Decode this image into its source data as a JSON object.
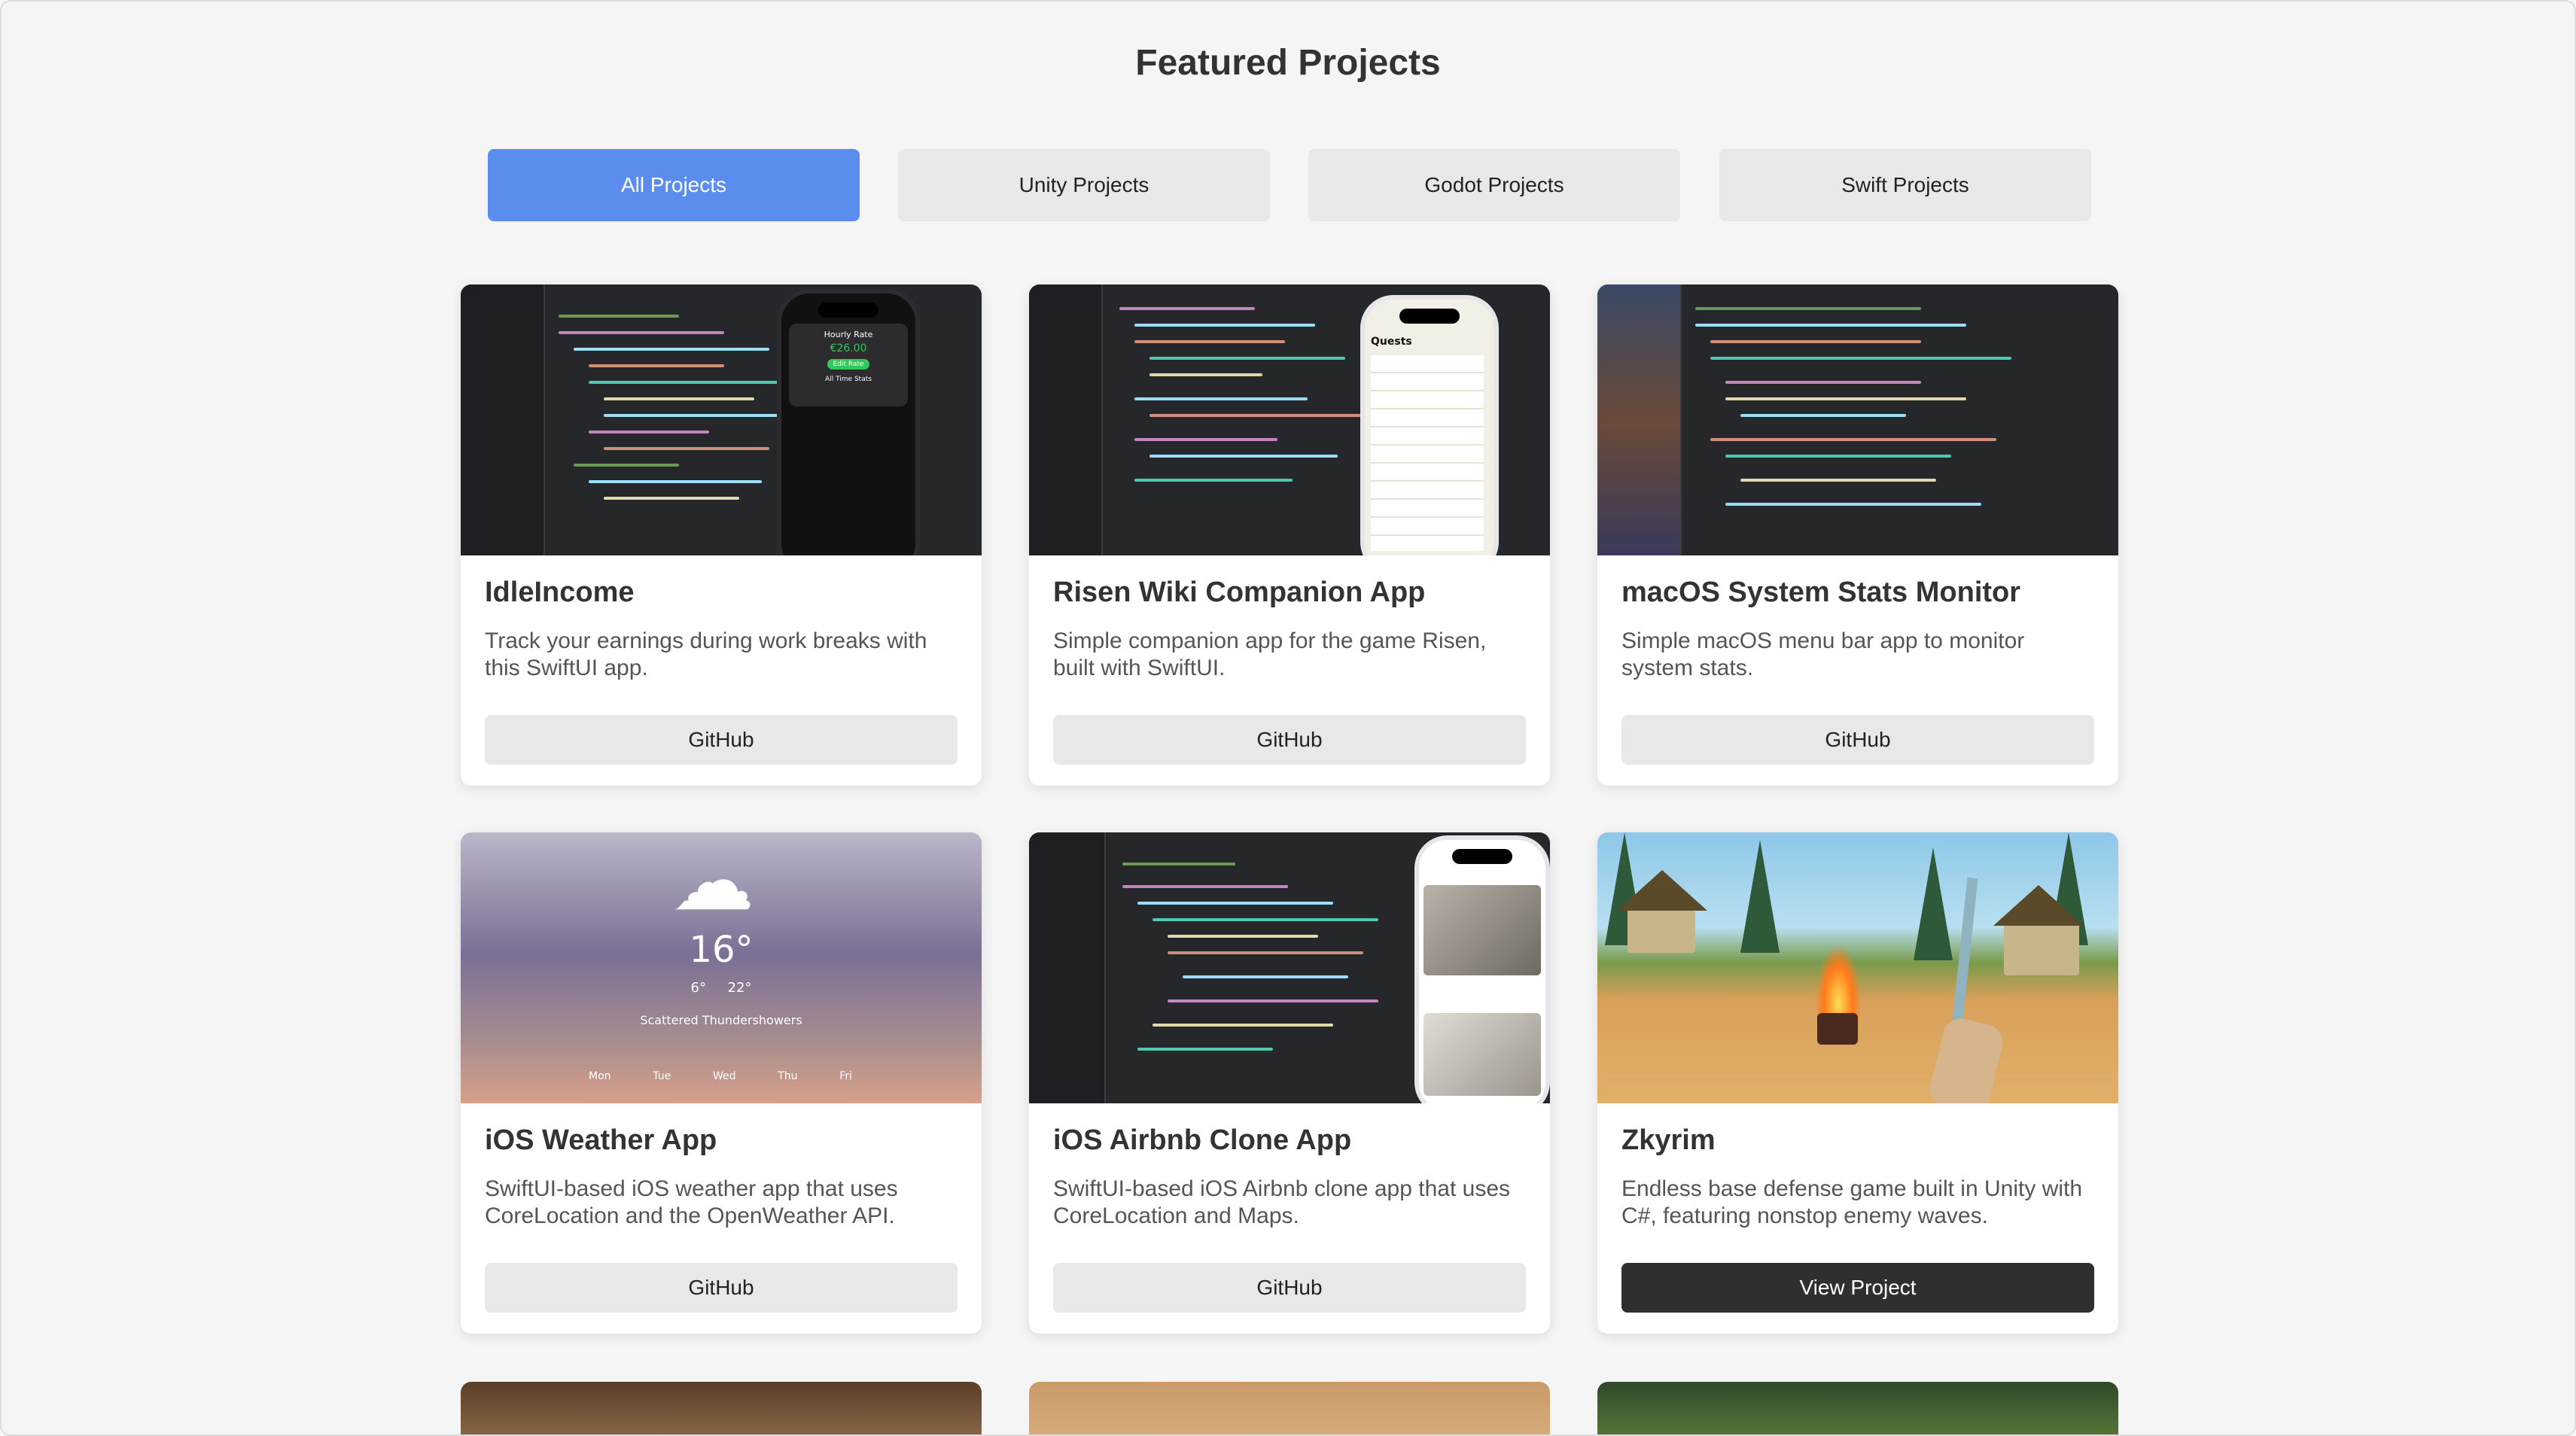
{
  "page": {
    "title": "Featured Projects"
  },
  "filters": [
    {
      "label": "All Projects",
      "active": true
    },
    {
      "label": "Unity Projects",
      "active": false
    },
    {
      "label": "Godot Projects",
      "active": false
    },
    {
      "label": "Swift Projects",
      "active": false
    }
  ],
  "projects": [
    {
      "title": "IdleIncome",
      "description": "Track your earnings during work breaks with this SwiftUI app.",
      "button": "GitHub",
      "preview": {
        "heading": "Hourly Rate",
        "amount": "€26.00",
        "action": "Edit Rate",
        "stats": "All Time Stats"
      }
    },
    {
      "title": "Risen Wiki Companion App",
      "description": "Simple companion app for the game Risen, built with SwiftUI.",
      "button": "GitHub",
      "preview": {
        "heading": "Quests"
      }
    },
    {
      "title": "macOS System Stats Monitor",
      "description": "Simple macOS menu bar app to monitor system stats.",
      "button": "GitHub"
    },
    {
      "title": "iOS Weather App",
      "description": "SwiftUI-based iOS weather app that uses CoreLocation and the OpenWeather API.",
      "button": "GitHub",
      "preview": {
        "temperature": "16°",
        "low": "6°",
        "high": "22°",
        "condition": "Scattered Thundershowers",
        "days": [
          "Mon",
          "Tue",
          "Wed",
          "Thu",
          "Fri"
        ]
      }
    },
    {
      "title": "iOS Airbnb Clone App",
      "description": "SwiftUI-based iOS Airbnb clone app that uses CoreLocation and Maps.",
      "button": "GitHub"
    },
    {
      "title": "Zkyrim",
      "description": "Endless base defense game built in Unity with C#, featuring nonstop enemy waves.",
      "button": "View Project",
      "button_style": "dark"
    }
  ],
  "colors": {
    "accent": "#5b8def",
    "background": "#f5f5f5",
    "dark_button": "#2f2f2f"
  }
}
